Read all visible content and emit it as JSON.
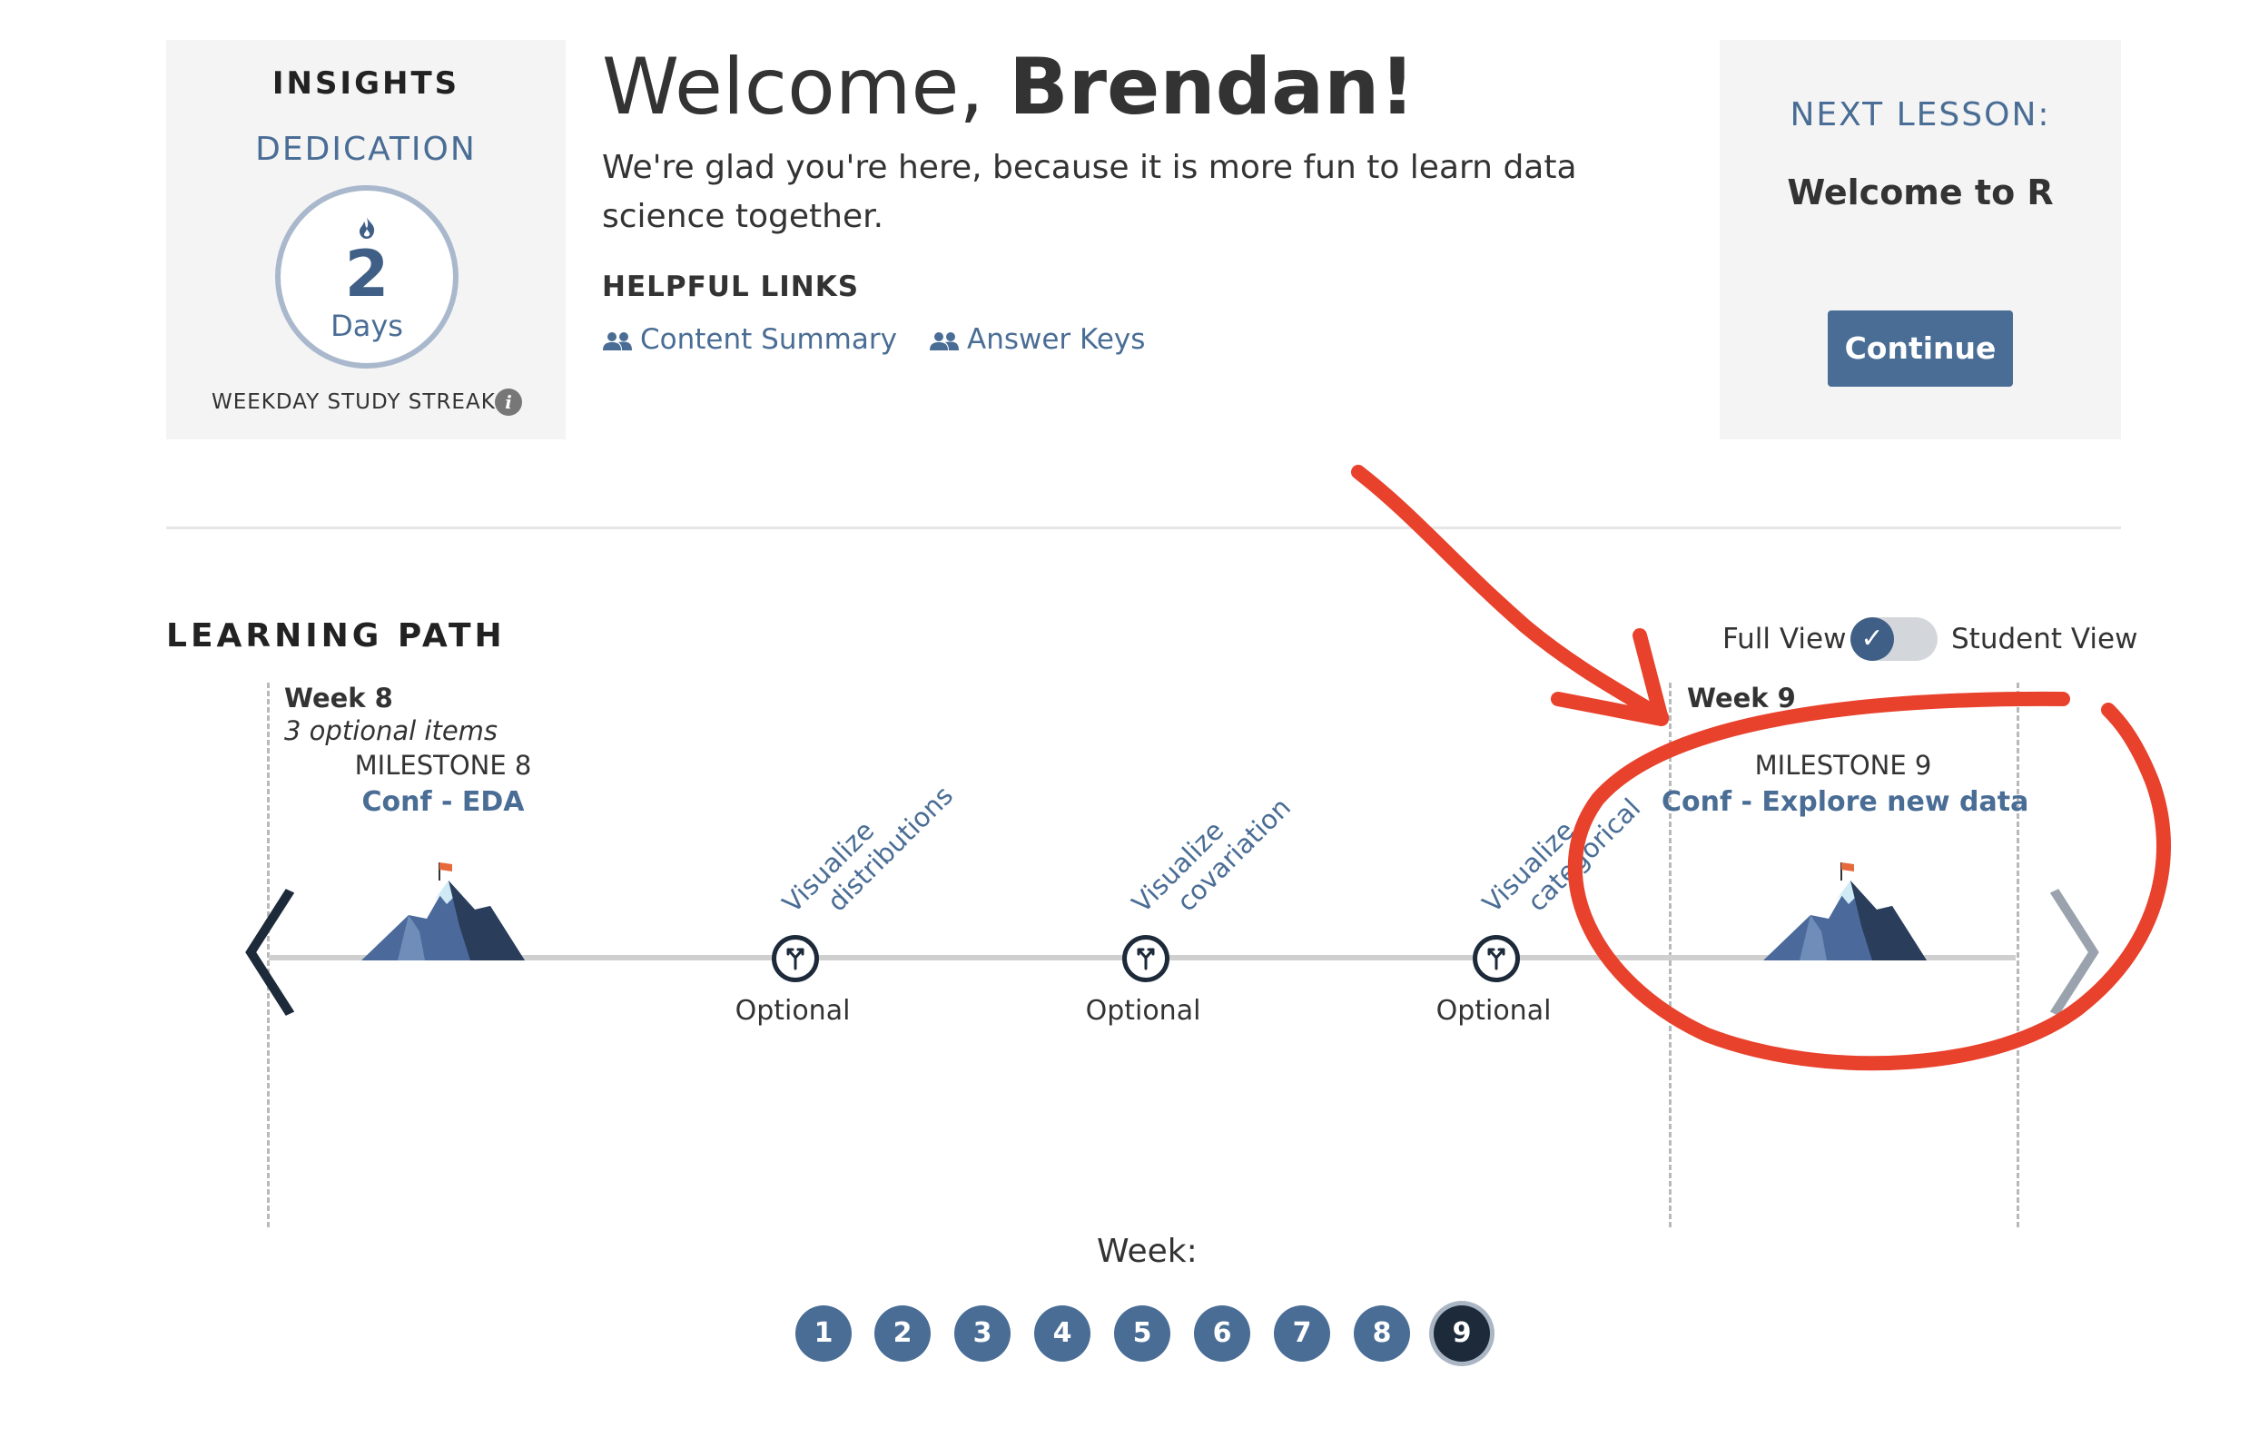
{
  "insights": {
    "title": "INSIGHTS",
    "section": "DEDICATION",
    "streak_icon": "flame-icon",
    "streak_value": "2",
    "streak_unit": "Days",
    "streak_label": "WEEKDAY STUDY STREAK",
    "info_icon": "i"
  },
  "welcome": {
    "greeting": "Welcome, ",
    "name": "Brendan!",
    "intro": "We're glad you're here, because it is more fun to learn data science together.",
    "helpful_links_title": "HELPFUL LINKS",
    "links": [
      "Content Summary",
      "Answer Keys"
    ]
  },
  "next_lesson": {
    "title": "NEXT LESSON:",
    "lesson": "Welcome to R",
    "button": "Continue"
  },
  "learning_path": {
    "title": "LEARNING PATH",
    "toggle": {
      "left_label": "Full View",
      "right_label": "Student View",
      "check": "✓"
    },
    "week8": {
      "header": "Week 8",
      "sub": "3 optional items",
      "milestone_label": "MILESTONE 8",
      "milestone_title": "Conf - EDA"
    },
    "week9": {
      "header": "Week 9",
      "milestone_label": "MILESTONE 9",
      "milestone_title": "Conf - Explore new data"
    },
    "optional_items": [
      {
        "title_line1": "Visualize",
        "title_line2": "distributions",
        "status": "Optional"
      },
      {
        "title_line1": "Visualize",
        "title_line2": "covariation",
        "status": "Optional"
      },
      {
        "title_line1": "Visualize",
        "title_line2": "categorical",
        "status": "Optional"
      }
    ],
    "nav": {
      "prev": "〈",
      "next": "〉"
    }
  },
  "week_pager": {
    "label": "Week:",
    "weeks": [
      "1",
      "2",
      "3",
      "4",
      "5",
      "6",
      "7",
      "8",
      "9"
    ],
    "active": "9"
  },
  "annotation_color": "#e8412c"
}
